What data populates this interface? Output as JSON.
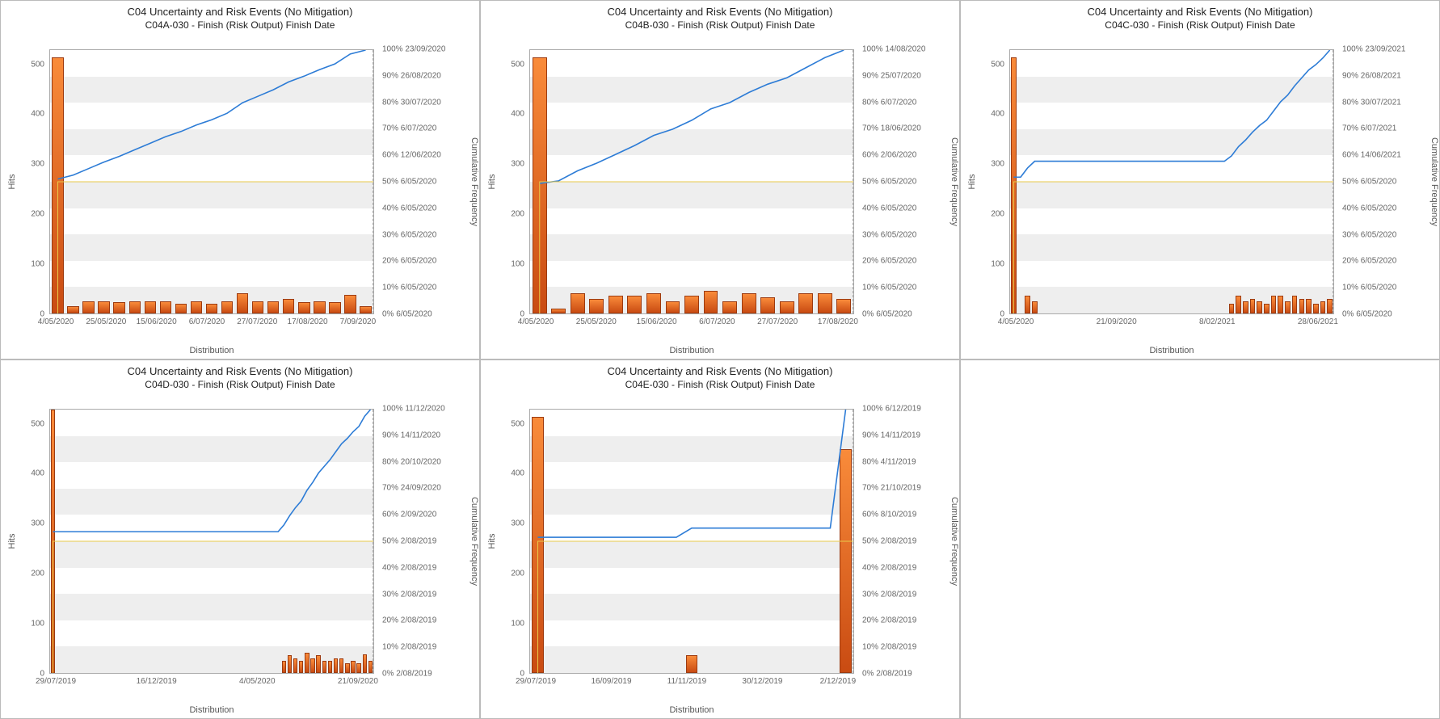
{
  "y_label": "Hits",
  "y2_label": "Cumulative Frequency",
  "x_label": "Distribution",
  "y_ticks": [
    0,
    100,
    200,
    300,
    400,
    500
  ],
  "y_max": 530,
  "y2_pct": [
    0,
    10,
    20,
    30,
    40,
    50,
    60,
    70,
    80,
    90,
    100
  ],
  "chart_data": [
    {
      "type": "bar+line",
      "title": "C04 Uncertainty and Risk Events (No Mitigation)",
      "subtitle": "C04A-030 - Finish (Risk Output) Finish Date",
      "x_ticks": [
        "4/05/2020",
        "25/05/2020",
        "15/06/2020",
        "6/07/2020",
        "27/07/2020",
        "17/08/2020",
        "7/09/2020"
      ],
      "y2_labels": [
        "0% 6/05/2020",
        "10% 6/05/2020",
        "20% 6/05/2020",
        "30% 6/05/2020",
        "40% 6/05/2020",
        "50% 6/05/2020",
        "60% 12/06/2020",
        "70% 6/07/2020",
        "80% 30/07/2020",
        "90% 26/08/2020",
        "100% 23/09/2020"
      ],
      "bars": [
        515,
        15,
        25,
        25,
        22,
        25,
        25,
        25,
        20,
        25,
        20,
        25,
        40,
        25,
        25,
        30,
        22,
        25,
        22,
        38,
        15
      ],
      "cum": [
        515,
        530,
        555,
        580,
        602,
        627,
        652,
        677,
        697,
        722,
        742,
        767,
        807,
        832,
        857,
        887,
        909,
        934,
        956,
        994,
        1009
      ],
      "total": 1009
    },
    {
      "type": "bar+line",
      "title": "C04 Uncertainty and Risk Events (No Mitigation)",
      "subtitle": "C04B-030 - Finish (Risk Output) Finish Date",
      "x_ticks": [
        "4/05/2020",
        "25/05/2020",
        "15/06/2020",
        "6/07/2020",
        "27/07/2020",
        "17/08/2020"
      ],
      "y2_labels": [
        "0% 6/05/2020",
        "10% 6/05/2020",
        "20% 6/05/2020",
        "30% 6/05/2020",
        "40% 6/05/2020",
        "50% 6/05/2020",
        "60% 2/06/2020",
        "70% 18/06/2020",
        "80% 6/07/2020",
        "90% 25/07/2020",
        "100% 14/08/2020"
      ],
      "bars": [
        515,
        10,
        40,
        30,
        35,
        35,
        40,
        25,
        35,
        45,
        25,
        40,
        33,
        25,
        40,
        40,
        30
      ],
      "cum": [
        515,
        525,
        565,
        595,
        630,
        665,
        705,
        730,
        765,
        810,
        835,
        875,
        908,
        933,
        973,
        1013,
        1043
      ],
      "total": 1043
    },
    {
      "type": "bar+line",
      "title": "C04 Uncertainty and Risk Events (No Mitigation)",
      "subtitle": "C04C-030 - Finish (Risk Output) Finish Date",
      "x_ticks": [
        "4/05/2020",
        "21/09/2020",
        "8/02/2021",
        "28/06/2021"
      ],
      "y2_labels": [
        "0% 6/05/2020",
        "10% 6/05/2020",
        "20% 6/05/2020",
        "30% 6/05/2020",
        "40% 6/05/2020",
        "50% 6/05/2020",
        "60% 14/06/2021",
        "70% 6/07/2021",
        "80% 30/07/2021",
        "90% 26/08/2021",
        "100% 23/09/2021"
      ],
      "bars": [
        515,
        0,
        35,
        25,
        0,
        0,
        0,
        0,
        0,
        0,
        0,
        0,
        0,
        0,
        0,
        0,
        0,
        0,
        0,
        0,
        0,
        0,
        0,
        0,
        0,
        0,
        0,
        0,
        0,
        0,
        0,
        20,
        35,
        25,
        30,
        25,
        20,
        35,
        35,
        25,
        35,
        30,
        30,
        20,
        25,
        30
      ],
      "cum": [
        515,
        515,
        550,
        575,
        575,
        575,
        575,
        575,
        575,
        575,
        575,
        575,
        575,
        575,
        575,
        575,
        575,
        575,
        575,
        575,
        575,
        575,
        575,
        575,
        575,
        575,
        575,
        575,
        575,
        575,
        575,
        595,
        630,
        655,
        685,
        710,
        730,
        765,
        800,
        825,
        860,
        890,
        920,
        940,
        965,
        995
      ],
      "total": 995
    },
    {
      "type": "bar+line",
      "title": "C04 Uncertainty and Risk Events (No Mitigation)",
      "subtitle": "C04D-030 - Finish (Risk Output) Finish Date",
      "x_ticks": [
        "29/07/2019",
        "16/12/2019",
        "4/05/2020",
        "21/09/2020"
      ],
      "y2_labels": [
        "0% 2/08/2019",
        "10% 2/08/2019",
        "20% 2/08/2019",
        "30% 2/08/2019",
        "40% 2/08/2019",
        "50% 2/08/2019",
        "60% 2/09/2020",
        "70% 24/09/2020",
        "80% 20/10/2020",
        "90% 14/11/2020",
        "100% 11/12/2020"
      ],
      "bars": [
        530,
        0,
        0,
        0,
        0,
        0,
        0,
        0,
        0,
        0,
        0,
        0,
        0,
        0,
        0,
        0,
        0,
        0,
        0,
        0,
        0,
        0,
        0,
        0,
        0,
        0,
        0,
        0,
        0,
        0,
        0,
        0,
        0,
        0,
        0,
        0,
        0,
        0,
        0,
        0,
        25,
        35,
        30,
        25,
        40,
        30,
        35,
        25,
        25,
        30,
        30,
        20,
        25,
        20,
        38,
        25
      ],
      "cum": [
        530,
        530,
        530,
        530,
        530,
        530,
        530,
        530,
        530,
        530,
        530,
        530,
        530,
        530,
        530,
        530,
        530,
        530,
        530,
        530,
        530,
        530,
        530,
        530,
        530,
        530,
        530,
        530,
        530,
        530,
        530,
        530,
        530,
        530,
        530,
        530,
        530,
        530,
        530,
        530,
        555,
        590,
        620,
        645,
        685,
        715,
        750,
        775,
        800,
        830,
        860,
        880,
        905,
        925,
        963,
        988
      ],
      "total": 988
    },
    {
      "type": "bar+line",
      "title": "C04 Uncertainty and Risk Events (No Mitigation)",
      "subtitle": "C04E-030 - Finish (Risk Output) Finish Date",
      "x_ticks": [
        "29/07/2019",
        "16/09/2019",
        "11/11/2019",
        "30/12/2019",
        "2/12/2019"
      ],
      "y2_labels": [
        "0% 2/08/2019",
        "10% 2/08/2019",
        "20% 2/08/2019",
        "30% 2/08/2019",
        "40% 2/08/2019",
        "50% 2/08/2019",
        "60% 8/10/2019",
        "70% 21/10/2019",
        "80% 4/11/2019",
        "90% 14/11/2019",
        "100% 6/12/2019"
      ],
      "bars": [
        515,
        0,
        0,
        0,
        0,
        0,
        0,
        0,
        0,
        0,
        35,
        0,
        0,
        0,
        0,
        0,
        0,
        0,
        0,
        0,
        450
      ],
      "cum": [
        515,
        515,
        515,
        515,
        515,
        515,
        515,
        515,
        515,
        515,
        550,
        550,
        550,
        550,
        550,
        550,
        550,
        550,
        550,
        550,
        1000
      ],
      "total": 1000
    }
  ]
}
